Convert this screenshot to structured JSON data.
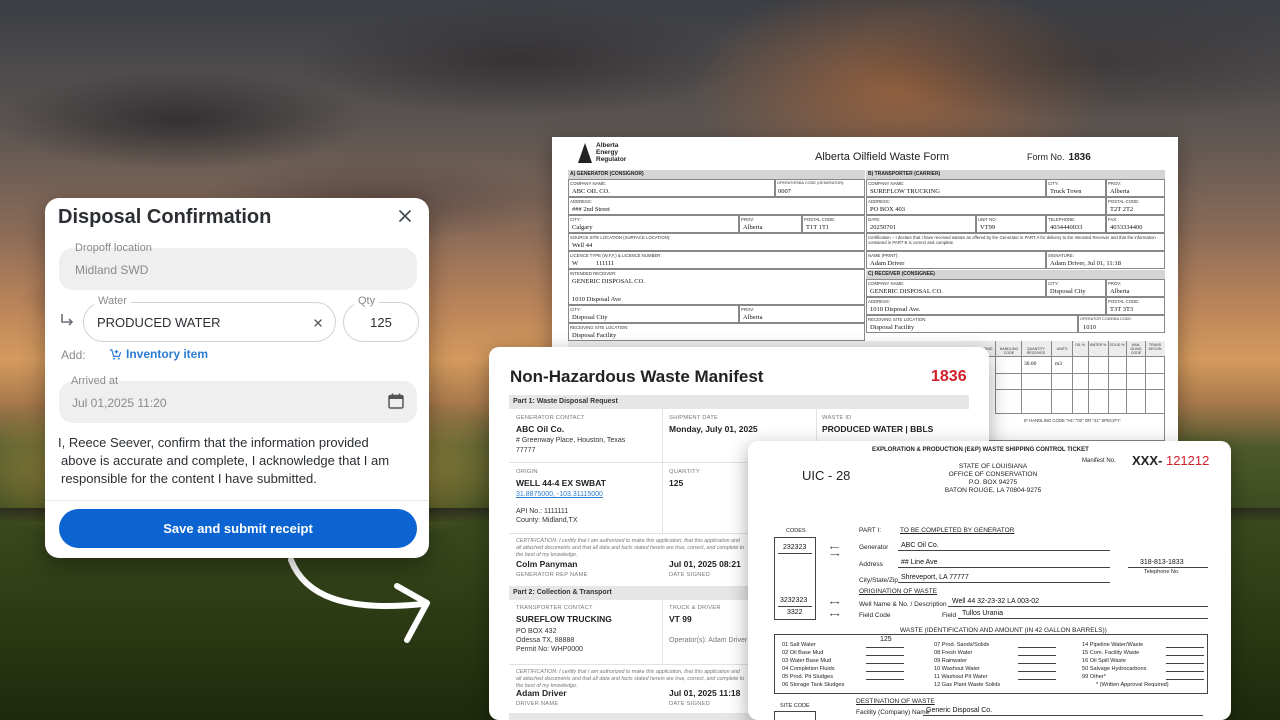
{
  "dialog": {
    "title": "Disposal Confirmation",
    "dropoff_label": "Dropoff location",
    "dropoff_value": "Midland SWD",
    "water_label": "Water",
    "water_value": "PRODUCED WATER",
    "qty_label": "Qty",
    "qty_value": "125",
    "add_label": "Add:",
    "inventory_label": "Inventory item",
    "arrived_label": "Arrived at",
    "arrived_value": "Jul 01,2025 11:20",
    "confirm_line1": "I, Reece Seever, confirm that the information provided",
    "confirm_line2": "above is accurate and complete, I acknowledge that I am",
    "confirm_line3": "responsible for the content I have submitted.",
    "submit_label": "Save and submit receipt"
  },
  "aer_form": {
    "logo_line1": "Alberta",
    "logo_line2": "Energy",
    "logo_line3": "Regulator",
    "title": "Alberta Oilfield Waste Form",
    "form_no_label": "Form No.",
    "form_no": "1836",
    "generator": {
      "section": "A) GENERATOR (CONSIGNOR)",
      "company_label": "COMPANY NAME:",
      "company": "ABC OIL CO.",
      "operator_label": "OPERATOR/BA CODE (GENERATOR):",
      "operator": "0007",
      "address_label": "ADDRESS:",
      "address": "### 2nd Street",
      "city_label": "CITY:",
      "city": "Calgary",
      "prov_label": "PROV:",
      "prov": "Alberta",
      "postal_label": "POSTAL CODE:",
      "postal": "T1T 1T1",
      "source_label": "SOURCE SITE LOCATION (SURFACE LOCATION):",
      "source": "Well 44",
      "licence_label": "LICENCE TYPE (W,F,F,) & LICENCE NUMBER:",
      "licence_type": "W",
      "licence_number": "111111",
      "receiver_label": "INTENDED RECEIVER:",
      "receiver": "GENERIC DISPOSAL CO.",
      "receiver_address": "1010 Disposal Ave",
      "receiver_city": "Disposal City",
      "receiver_prov": "Alberta",
      "receiving_site_label": "RECEIVING SITE LOCATION:",
      "receiving_site": "Disposal Facility"
    },
    "transporter": {
      "section": "B) TRANSPORTER (CARRIER)",
      "company_label": "COMPANY NAME:",
      "company": "SUREFLOW TRUCKING",
      "city_label": "CITY:",
      "city": "Truck Town",
      "prov_label": "PROV:",
      "prov": "Alberta",
      "address_label": "ADDRESS:",
      "address": "PO BOX 403",
      "postal_label": "POSTAL CODE:",
      "postal": "T2T 2T2",
      "date_label": "DATE:",
      "date": "20250701",
      "unit_label": "UNIT NO:",
      "unit": "VT99",
      "tel_label": "TELEPHONE:",
      "tel": "4034440033",
      "fax_label": "FAX:",
      "fax": "4033334400",
      "certification": "Certification – I declare that I have received wastes as offered by the Generator in PART A for delivery to the Intended Receiver and that the information contained in PART B is correct and complete.",
      "name_label": "NAME (PRINT):",
      "name": "Adam Driver",
      "signature_label": "SIGNATURE:",
      "signature": "Adam Driver, Jul 01, 11:18"
    },
    "receiver": {
      "section": "C) RECEIVER (CONSIGNEE)",
      "company_label": "COMPANY NAME:",
      "company": "GENERIC DISPOSAL CO.",
      "city_label": "CITY:",
      "city": "Disposal City",
      "prov_label": "PROV:",
      "prov": "Alberta",
      "address_label": "ADDRESS:",
      "address": "1010 Disposal Ave.",
      "postal_label": "POSTAL CODE:",
      "postal": "T3T 3T3",
      "site_label": "RECEIVING SITE LOCATION:",
      "site": "Disposal Facility",
      "operator_label": "OPERATOR CODE/BA CODE:",
      "operator": "1010"
    },
    "table_headers": [
      "PACKAGING",
      "HANDLING CODE",
      "QUANTITY RECEIVED",
      "UNITS",
      "OIL %",
      "WATER %",
      "SOLID %",
      "HAN-DLING CODE",
      "TRANS DECON"
    ],
    "quantity_received": "30.00",
    "units": "m3",
    "handling_note": "IF HANDLING CODE \"H1\",\"02\" OR \"21\" SPECIFY:"
  },
  "manifest": {
    "title": "Non-Hazardous Waste Manifest",
    "number": "1836",
    "part1": "Part 1: Waste Disposal Request",
    "generator_contact_label": "GENERATOR CONTACT",
    "generator_company": "ABC Oil Co.",
    "generator_address_line1": "# Greenway Place, Houston, Texas",
    "generator_address_line2": "77777",
    "shipment_date_label": "SHIPMENT DATE",
    "shipment_date": "Monday, July 01, 2025",
    "waste_id_label": "WASTE ID",
    "waste_id": "PRODUCED WATER | BBLS",
    "origin_label": "ORIGIN",
    "origin": "WELL 44-4 EX SWBAT",
    "origin_coords": "31.8875000, -103.31115000",
    "quantity_label": "QUANTITY",
    "quantity": "125",
    "api_label": "API No.:",
    "api": "1111111",
    "county_label": "County:",
    "county": "Midland,TX",
    "certification": "CERTIFICATION: I certify that I am authorized to make this application, that this application and all attached documents and that all data and facts stated herein are true, correct, and complete to the best of my knowledge.",
    "gen_rep": "Colm Panyman",
    "gen_rep_label": "GENERATOR REP NAME",
    "date_signed": "Jul 01, 2025 08:21",
    "date_signed_label": "DATE SIGNED",
    "part2": "Part 2: Collection & Transport",
    "transporter_label": "TRANSPORTER CONTACT",
    "transporter": "SUREFLOW TRUCKING",
    "transporter_addr1": "PO BOX 432",
    "transporter_addr2": "Odessa TX, 88888",
    "transporter_permit": "Permit No: WHP0000",
    "truck_driver_label": "TRUCK & DRIVER",
    "truck": "VT 99",
    "operators_label": "Operator(s):",
    "operators": "Adam Driver",
    "certification2": "CERTIFICATION: I certify that I am authorized to make this application, that this application and all attached documents and that all data and facts stated herein are true, correct, and complete to the best of my knowledge.",
    "driver": "Adam Driver",
    "driver_label": "DRIVER NAME",
    "date_signed2": "Jul 01, 2025 11:18",
    "date_signed2_label": "DATE SIGNED"
  },
  "uic": {
    "title": "EXPLORATION & PRODUCTION (E&P) WASTE SHIPPING CONTROL TICKET",
    "code": "UIC - 28",
    "state_line1": "STATE OF LOUISIANA",
    "state_line2": "OFFICE OF CONSERVATION",
    "state_line3": "P.O. BOX 94275",
    "state_line4": "BATON ROUGE, LA 70804-9275",
    "manifest_label": "Manifest No.",
    "manifest_prefix": "XXX-",
    "manifest_number": "121212",
    "codes_label": "CODES",
    "code1": "232323",
    "code2": "3232323",
    "code3": "3322",
    "part1_label": "PART I:",
    "part1_title": "TO BE COMPLETED BY GENERATOR",
    "generator_label": "Generator",
    "generator": "ABC Oil Co.",
    "address_label": "Address",
    "address": "## Line Ave",
    "phone": "318-813-1833",
    "phone_label": "Telephone No.",
    "city_label": "City/State/Zip",
    "city": "Shreveport, LA 77777",
    "origination_label": "ORIGINATION OF WASTE",
    "well_label": "Well Name & No. / Description",
    "well": "Well 44 32-23-32  LA 003-02",
    "field_code_label": "Field Code",
    "field_label": "Field",
    "field": "Tullos Urania",
    "waste_header": "WASTE (IDENTIFICATION AND AMOUNT (IN 42 GALLON BARRELS))",
    "col1": [
      "01  Salt Water",
      "02  Oil Base Mud",
      "03  Water Base Mud",
      "04  Completion Fluids",
      "05  Prod. Pit Sludges",
      "06  Storage Tank Sludges"
    ],
    "col1_amount": "125",
    "col2": [
      "07  Prod. Sands/Solids",
      "08  Fresh Water",
      "09  Rainwater",
      "10  Washout Water",
      "11  Washout Pit Water",
      "12  Gas Plant Waste Solids"
    ],
    "col3": [
      "14  Pipeline Water/Waste",
      "15  Com. Facility Waste",
      "16  Oil Spill Waste",
      "50  Salvage Hydrocarbons",
      "99  Other*",
      "* (Written Approval Required)"
    ],
    "site_code_label": "SITE CODE",
    "destination_label": "DESTINATION OF WASTE",
    "facility_label": "Facility (Company) Name",
    "facility": "Generic Disposal Co."
  }
}
